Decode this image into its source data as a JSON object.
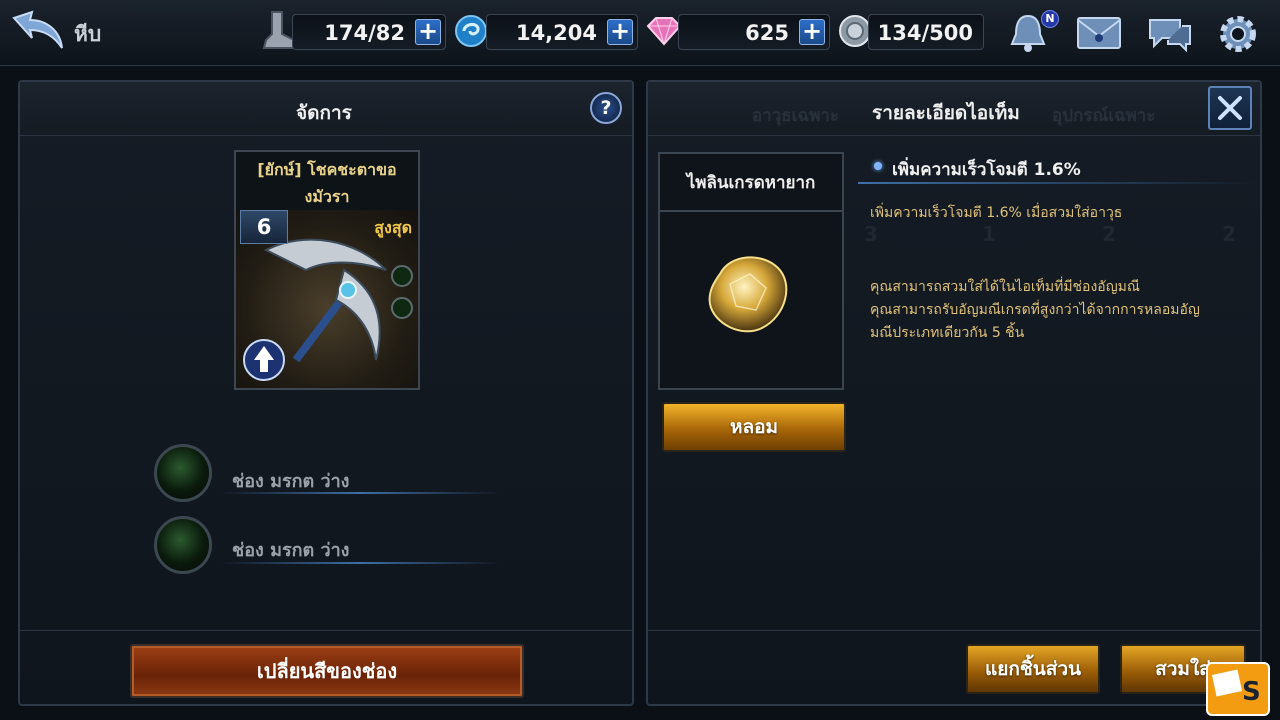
{
  "header": {
    "title": "หีบ",
    "resources": [
      {
        "name": "stamina",
        "icon": "boot-icon",
        "value": "174/82"
      },
      {
        "name": "gold",
        "icon": "blue-orb-icon",
        "value": "14,204"
      },
      {
        "name": "gem",
        "icon": "diamond-icon",
        "value": "625"
      },
      {
        "name": "inventory",
        "icon": "silver-orb-icon",
        "value": "134/500"
      }
    ],
    "notification_badge": "N"
  },
  "left_panel": {
    "title": "จัดการ",
    "item": {
      "name_line1": "[ยักษ์] โชคชะตาขอ",
      "name_line2": "งมัวรา",
      "level": "6",
      "grade": "สูงสุด"
    },
    "slots": [
      {
        "label": "ช่อง มรกต ว่าง"
      },
      {
        "label": "ช่อง มรกต ว่าง"
      }
    ],
    "change_color_button": "เปลี่ยนสีของช่อง"
  },
  "right_panel": {
    "ghost_tab_left": "อาวุธเฉพาะ",
    "title": "รายละเอียดไอเท็ม",
    "ghost_tab_right": "อุปกรณ์เฉพาะ",
    "gem_name": "ไพลินเกรดหายาก",
    "fuse_button": "หลอม",
    "stat_title": "เพิ่มความเร็วโจมตี 1.6%",
    "stat_desc": "เพิ่มความเร็วโจมตี 1.6% เมื่อสวมใส่อาวุธ",
    "info_line1": "คุณสามารถสวมใส่ได้ในไอเท็มที่มีช่องอัญมณี",
    "info_line2": "คุณสามารถรับอัญมณีเกรดที่สูงกว่าได้จากการหลอมอัญ",
    "info_line3": "มณีประเภทเดียวกัน 5 ชิ้น",
    "ghost_numbers": [
      "3",
      "1",
      "2",
      "2"
    ],
    "dismantle_button": "แยกชิ้นส่วน",
    "equip_button": "สวมใส่"
  },
  "colors": {
    "accent_blue": "#2c6fc9",
    "gold_button": "#e4a625",
    "orange_button": "#9d3f14",
    "gold_text": "#e0c27a"
  }
}
